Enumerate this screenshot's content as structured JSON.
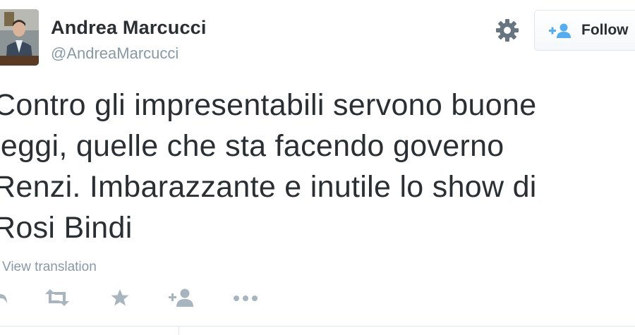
{
  "profile": {
    "name": "Andrea Marcucci",
    "handle": "@AndreaMarcucci"
  },
  "header": {
    "follow_label": "Follow",
    "follow_icon": "add-user-icon",
    "settings_icon": "gear-icon"
  },
  "tweet": {
    "text": "Contro gli impresentabili servono buone\nleggi, quelle che sta facendo governo\nRenzi. Imbarazzante e inutile lo show di\nRosi Bindi",
    "translate_label": "View translation"
  },
  "actions": [
    "reply-icon",
    "retweet-icon",
    "favorite-icon",
    "follow-icon",
    "more-icon"
  ],
  "colors": {
    "text": "#292f33",
    "muted": "#8899a6",
    "icon": "#a8b5bf",
    "border": "#e1e8ed"
  }
}
